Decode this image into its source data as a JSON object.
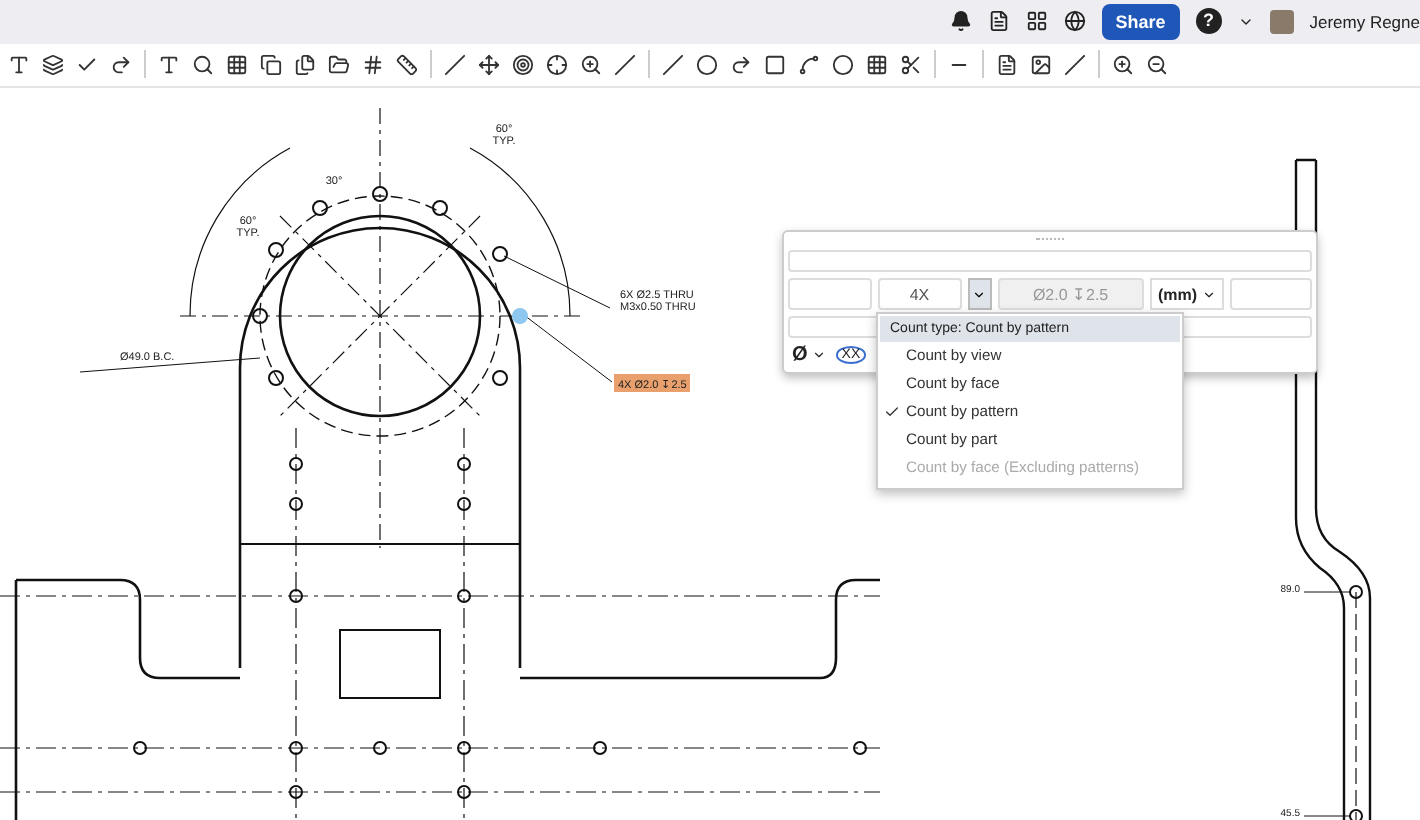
{
  "header": {
    "share_label": "Share",
    "help_label": "?",
    "user_name": "Jeremy Regne"
  },
  "drawing": {
    "labels": [
      {
        "kind": "angle",
        "lines": [
          "30°"
        ]
      },
      {
        "kind": "angle",
        "lines": [
          "60°",
          "TYP."
        ]
      },
      {
        "kind": "angle",
        "lines": [
          "60°",
          "TYP."
        ]
      },
      {
        "kind": "note",
        "lines": [
          "6X Ø2.5 THRU",
          "M3x0.50 THRU"
        ]
      },
      {
        "kind": "note",
        "lines": [
          "Ø49.0 B.C."
        ]
      },
      {
        "kind": "dim",
        "lines": [
          "89.0"
        ]
      },
      {
        "kind": "dim",
        "lines": [
          "45.5"
        ]
      }
    ],
    "callout": {
      "text": "4X Ø2.0 ↧2.5",
      "selected": true
    }
  },
  "dialog": {
    "count": "4X",
    "value": "Ø2.0 ↧2.5",
    "units": "(mm)",
    "symbol": "Ø",
    "tolerance": "XX"
  },
  "menu": {
    "header": "Count type: Count by pattern",
    "items": [
      {
        "label": "Count by view",
        "selected": false,
        "disabled": false
      },
      {
        "label": "Count by face",
        "selected": false,
        "disabled": false
      },
      {
        "label": "Count by pattern",
        "selected": true,
        "disabled": false
      },
      {
        "label": "Count by part",
        "selected": false,
        "disabled": false
      },
      {
        "label": "Count by face (Excluding patterns)",
        "selected": false,
        "disabled": true
      }
    ]
  }
}
